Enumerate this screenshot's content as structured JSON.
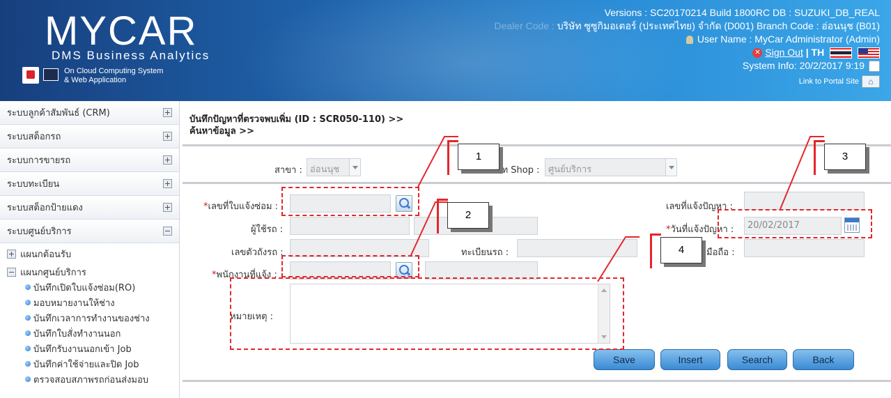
{
  "header": {
    "logo_title": "MYCAR",
    "logo_subtitle": "DMS Business Analytics",
    "cloud_line1": "On Cloud Computing System",
    "cloud_line2": "& Web Application",
    "version": "Versions : SC20170214 Build 1800RC DB : SUZUKI_DB_REAL",
    "dealer_label": "Dealer Code :",
    "dealer_value": "บริษัท ซูซูกิมอเตอร์ (ประเทศไทย) จำกัด (D001)  Branch Code : อ่อนนุช (B01)",
    "user": "User Name : MyCar Administrator  (Admin)",
    "sign_out": "Sign Out",
    "lang_th": "| TH",
    "system_info": "System Info: 20/2/2017 9:19",
    "portal_link": "Link to Portal Site"
  },
  "sidebar": {
    "menus": [
      {
        "label": "ระบบลูกค้าสัมพันธ์ (CRM)",
        "expanded": false
      },
      {
        "label": "ระบบสต็อกรถ",
        "expanded": false
      },
      {
        "label": "ระบบการขายรถ",
        "expanded": false
      },
      {
        "label": "ระบบทะเบียน",
        "expanded": false
      },
      {
        "label": "ระบบสต็อกป้ายแดง",
        "expanded": false
      },
      {
        "label": "ระบบศูนย์บริการ",
        "expanded": true
      }
    ],
    "sub_heads": [
      "แผนกต้อนรับ",
      "แผนกศูนย์บริการ"
    ],
    "sub_items": [
      "บันทึกเปิดใบแจ้งซ่อม(RO)",
      "มอบหมายงานให้ช่าง",
      "บันทึกเวลาการทำงานของช่าง",
      "บันทึกใบสั่งทำงานนอก",
      "บันทึกรับงานนอกเข้า Job",
      "บันทึกค่าใช้จ่ายและปิด Job",
      "ตรวจสอบสภาพรถก่อนส่งมอบ"
    ]
  },
  "main": {
    "title": "บันทึกปัญหาที่ตรวจพบเพิ่ม (ID : SCR050-110) >>",
    "subtitle": "ค้นหาข้อมูล >>",
    "branch_label": "สาขา :",
    "branch_value": "อ่อนนุช",
    "shop_label": "ภท Shop :",
    "shop_value": "ศูนย์บริการ",
    "repair_no_label": "เลขที่ใบแจ้งซ่อม :",
    "user_label": "ผู้ใช้รถ :",
    "chassis_label": "เลขตัวถังรถ :",
    "plate_label": "ทะเบียนรถ :",
    "employee_label": "พนักงานที่แจ้ง :",
    "problem_no_label": "เลขที่แจ้งปัญหา :",
    "problem_date_label": "วันที่แจ้งปัญหา :",
    "problem_date_value": "20/02/2017",
    "mobile_label": "มือถือ :",
    "remark_label": "หมายเหตุ :",
    "required_mark": "*",
    "buttons": {
      "save": "Save",
      "insert": "Insert",
      "search": "Search",
      "back": "Back"
    }
  },
  "annotations": {
    "c1": "1",
    "c2": "2",
    "c3": "3",
    "c4": "4"
  }
}
